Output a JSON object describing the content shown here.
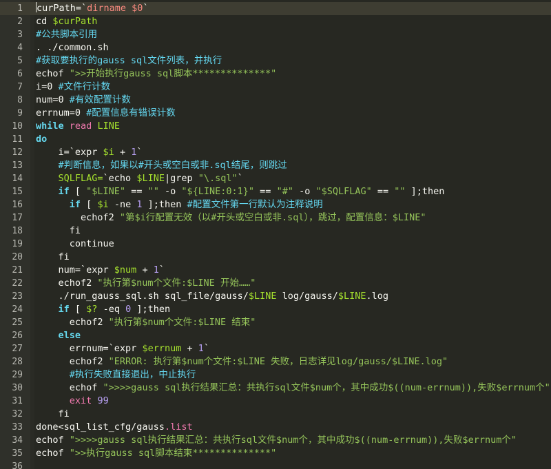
{
  "editor": {
    "current_line": 1,
    "colors": {
      "background": "#272822",
      "gutter": "#2f302a",
      "current_line": "#3e3d32",
      "keyword": "#66d9ef",
      "variable": "#a6e22e",
      "string": "#95c45a",
      "comment": "#64d7f0",
      "number": "#b9a1f5"
    }
  },
  "lines": [
    {
      "n": "1",
      "t": [
        [
          "curPath=`",
          "plain"
        ],
        [
          "dirname $0",
          "red"
        ],
        [
          "`",
          "plain"
        ]
      ]
    },
    {
      "n": "2",
      "t": [
        [
          "cd ",
          "plain"
        ],
        [
          "$curPath",
          "var"
        ]
      ]
    },
    {
      "n": "3",
      "t": [
        [
          "#公共脚本引用",
          "cmt"
        ]
      ]
    },
    {
      "n": "4",
      "t": [
        [
          ". ./common.sh",
          "plain"
        ]
      ]
    },
    {
      "n": "5",
      "t": [
        [
          "#获取要执行的gauss sql文件列表，并执行",
          "cmt"
        ]
      ]
    },
    {
      "n": "6",
      "t": [
        [
          "echof ",
          "plain"
        ],
        [
          "\">>开始执行gauss sql脚本**************\"",
          "str"
        ]
      ]
    },
    {
      "n": "7",
      "t": [
        [
          "i=0 ",
          "plain"
        ],
        [
          "#文件行计数",
          "cmt"
        ]
      ]
    },
    {
      "n": "8",
      "t": [
        [
          "num=0 ",
          "plain"
        ],
        [
          "#有效配置计数",
          "cmt"
        ]
      ]
    },
    {
      "n": "9",
      "t": [
        [
          "errnum=0 ",
          "plain"
        ],
        [
          "#配置信息有错误计数",
          "cmt"
        ]
      ]
    },
    {
      "n": "10",
      "t": [
        [
          "while",
          "kw"
        ],
        [
          " ",
          "plain"
        ],
        [
          "read",
          "mag"
        ],
        [
          " ",
          "plain"
        ],
        [
          "LINE",
          "var"
        ]
      ]
    },
    {
      "n": "11",
      "t": [
        [
          "do",
          "kw"
        ]
      ]
    },
    {
      "n": "12",
      "t": [
        [
          "    i=`expr ",
          "plain"
        ],
        [
          "$i",
          "var"
        ],
        [
          " + ",
          "plain"
        ],
        [
          "1",
          "num"
        ],
        [
          "`",
          "plain"
        ]
      ]
    },
    {
      "n": "13",
      "t": [
        [
          "    ",
          "plain"
        ],
        [
          "#判断信息，如果以#开头或空白或非.sql结尾，则跳过",
          "cmt"
        ]
      ]
    },
    {
      "n": "14",
      "t": [
        [
          "    ",
          "plain"
        ],
        [
          "SQLFLAG=",
          "var"
        ],
        [
          "`echo ",
          "plain"
        ],
        [
          "$LINE",
          "var"
        ],
        [
          "|grep ",
          "plain"
        ],
        [
          "\"\\.sql\"",
          "str"
        ],
        [
          "`",
          "plain"
        ]
      ]
    },
    {
      "n": "15",
      "t": [
        [
          "    ",
          "plain"
        ],
        [
          "if",
          "kw"
        ],
        [
          " [ ",
          "plain"
        ],
        [
          "\"$LINE\"",
          "str"
        ],
        [
          " == ",
          "plain"
        ],
        [
          "\"\"",
          "str"
        ],
        [
          " -o ",
          "plain"
        ],
        [
          "\"${LINE:0:1}\"",
          "str"
        ],
        [
          " == ",
          "plain"
        ],
        [
          "\"#\"",
          "str"
        ],
        [
          " -o ",
          "plain"
        ],
        [
          "\"$SQLFLAG\"",
          "str"
        ],
        [
          " == ",
          "plain"
        ],
        [
          "\"\"",
          "str"
        ],
        [
          " ];then",
          "plain"
        ]
      ]
    },
    {
      "n": "16",
      "t": [
        [
          "      ",
          "plain"
        ],
        [
          "if",
          "kw"
        ],
        [
          " [ ",
          "plain"
        ],
        [
          "$i",
          "var"
        ],
        [
          " -ne ",
          "plain"
        ],
        [
          "1",
          "num"
        ],
        [
          " ];then ",
          "plain"
        ],
        [
          "#配置文件第一行默认为注释说明",
          "cmt"
        ]
      ]
    },
    {
      "n": "17",
      "t": [
        [
          "        echof2 ",
          "plain"
        ],
        [
          "\"第$i行配置无效（以#开头或空白或非.sql），跳过，配置信息：$LINE\"",
          "str"
        ]
      ]
    },
    {
      "n": "18",
      "t": [
        [
          "      fi",
          "plain"
        ]
      ]
    },
    {
      "n": "19",
      "t": [
        [
          "      continue",
          "plain"
        ]
      ]
    },
    {
      "n": "20",
      "t": [
        [
          "    fi",
          "plain"
        ]
      ]
    },
    {
      "n": "21",
      "t": [
        [
          "    num=`expr ",
          "plain"
        ],
        [
          "$num",
          "var"
        ],
        [
          " + ",
          "plain"
        ],
        [
          "1",
          "num"
        ],
        [
          "`",
          "plain"
        ]
      ]
    },
    {
      "n": "22",
      "t": [
        [
          "    echof2 ",
          "plain"
        ],
        [
          "\"执行第$num个文件:$LINE 开始……\"",
          "str"
        ]
      ]
    },
    {
      "n": "23",
      "t": [
        [
          "    ./run_gauss_sql.sh sql_file/gauss/",
          "plain"
        ],
        [
          "$LINE",
          "var"
        ],
        [
          " log/gauss/",
          "plain"
        ],
        [
          "$LINE",
          "var"
        ],
        [
          ".log",
          "plain"
        ]
      ]
    },
    {
      "n": "24",
      "t": [
        [
          "    ",
          "plain"
        ],
        [
          "if",
          "kw"
        ],
        [
          " [ ",
          "plain"
        ],
        [
          "$?",
          "var"
        ],
        [
          " -eq ",
          "plain"
        ],
        [
          "0",
          "num"
        ],
        [
          " ];then",
          "plain"
        ]
      ]
    },
    {
      "n": "25",
      "t": [
        [
          "      echof2 ",
          "plain"
        ],
        [
          "\"执行第$num个文件:$LINE 结束\"",
          "str"
        ]
      ]
    },
    {
      "n": "26",
      "t": [
        [
          "    ",
          "plain"
        ],
        [
          "else",
          "kw"
        ]
      ]
    },
    {
      "n": "27",
      "t": [
        [
          "      errnum=`expr ",
          "plain"
        ],
        [
          "$errnum",
          "var"
        ],
        [
          " + ",
          "plain"
        ],
        [
          "1",
          "num"
        ],
        [
          "`",
          "plain"
        ]
      ]
    },
    {
      "n": "28",
      "t": [
        [
          "      echof2 ",
          "plain"
        ],
        [
          "\"ERROR: 执行第$num个文件:$LINE 失败，日志详见log/gauss/$LINE.log\"",
          "str"
        ]
      ]
    },
    {
      "n": "29",
      "t": [
        [
          "      ",
          "plain"
        ],
        [
          "#执行失败直接退出，中止执行",
          "cmt"
        ]
      ]
    },
    {
      "n": "30",
      "t": [
        [
          "      echof ",
          "plain"
        ],
        [
          "\">>>>gauss sql执行结果汇总：共执行sql文件$num个，其中成功$((num-errnum)),失败$errnum个\"",
          "str"
        ]
      ]
    },
    {
      "n": "31",
      "t": [
        [
          "      ",
          "plain"
        ],
        [
          "exit",
          "mag"
        ],
        [
          " ",
          "plain"
        ],
        [
          "99",
          "num"
        ]
      ]
    },
    {
      "n": "32",
      "t": [
        [
          "    fi",
          "plain"
        ]
      ]
    },
    {
      "n": "33",
      "t": [
        [
          "done<sql_list_cfg/gauss",
          "plain"
        ],
        [
          ".list",
          "mag"
        ]
      ]
    },
    {
      "n": "34",
      "t": [
        [
          "echof ",
          "plain"
        ],
        [
          "\">>>>gauss sql执行结果汇总：共执行sql文件$num个，其中成功$((num-errnum)),失败$errnum个\"",
          "str"
        ]
      ]
    },
    {
      "n": "35",
      "t": [
        [
          "echof ",
          "plain"
        ],
        [
          "\">>执行gauss sql脚本结束**************\"",
          "str"
        ]
      ]
    },
    {
      "n": "36",
      "t": [
        [
          "",
          "plain"
        ]
      ]
    }
  ]
}
